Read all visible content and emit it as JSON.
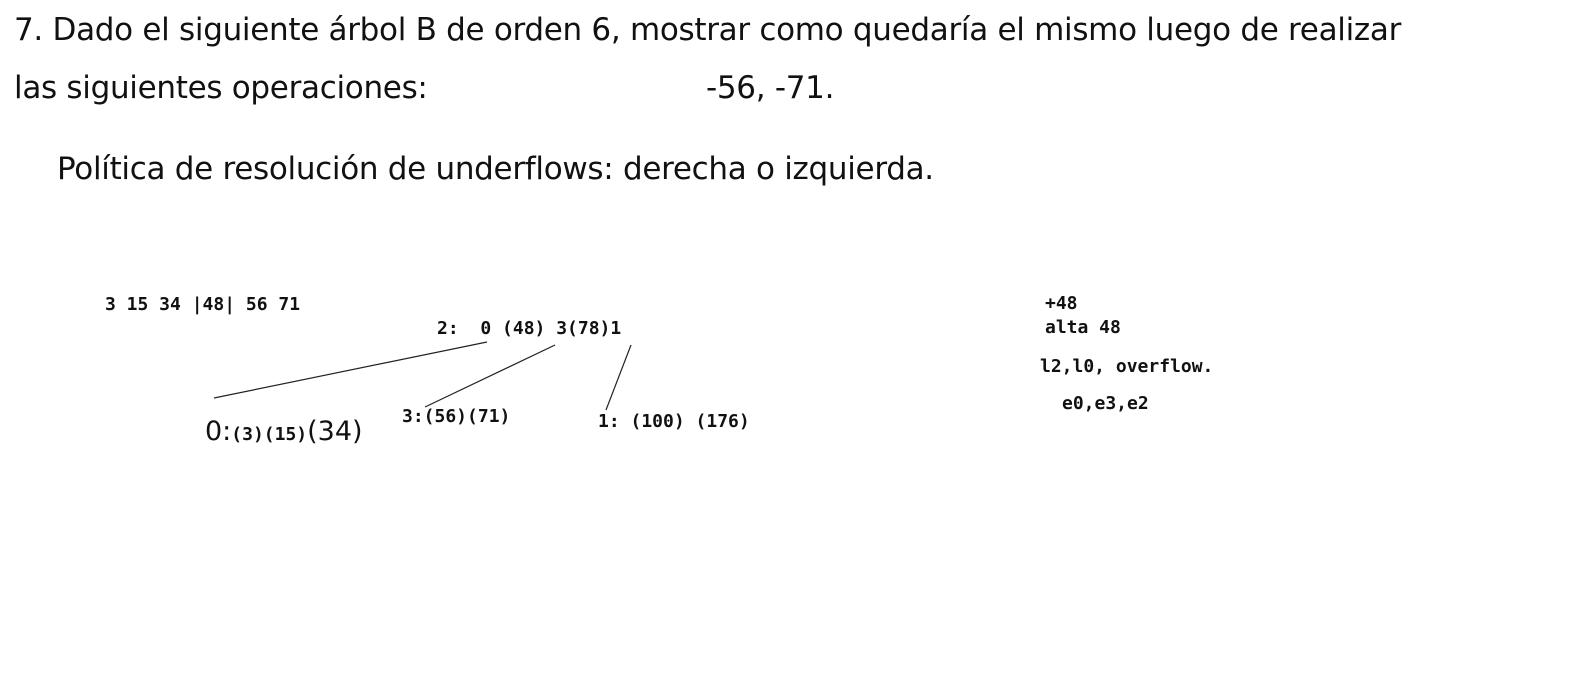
{
  "question": {
    "line1": "7. Dado el siguiente árbol B de orden 6, mostrar como quedaría el mismo luego de realizar",
    "line2_label": "las siguientes operaciones:",
    "operations": "-56, -71.",
    "policy": "Política de resolución de underflows: derecha o izquierda."
  },
  "scratch": {
    "sequence": "3 15 34 |48| 56 71",
    "root_node": "2:  0 (48) 3(78)1",
    "leaf_0_label": "0:",
    "leaf_0_small": "(3)(15)",
    "leaf_0_large": "(34)",
    "leaf_3": "3:(56)(71)",
    "leaf_1": "1: (100) (176)"
  },
  "notes": {
    "line1": "+48",
    "line2": "alta 48",
    "line3": "l2,l0, overflow.",
    "line4": "e0,e3,e2"
  }
}
